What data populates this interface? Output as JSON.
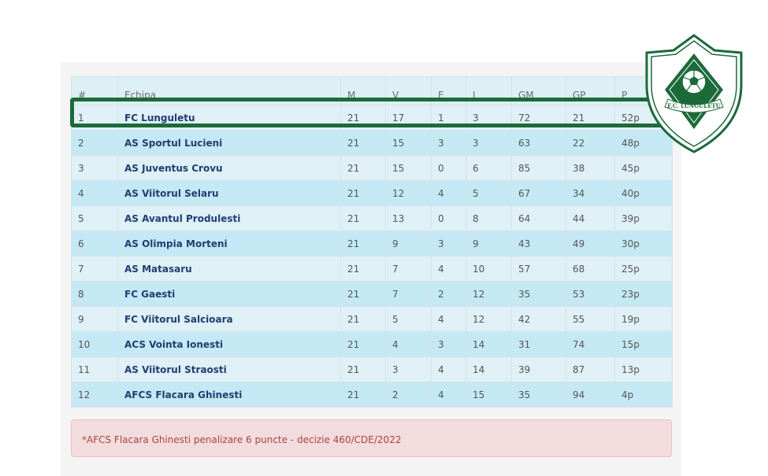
{
  "table": {
    "headers": {
      "rank": "#",
      "team": "Echipa",
      "played": "M",
      "won": "V",
      "drawn": "E",
      "lost": "I",
      "goals_for": "GM",
      "goals_against": "GP",
      "points": "P"
    },
    "rows": [
      {
        "rank": "1",
        "team": "FC Lunguletu",
        "played": "21",
        "won": "17",
        "drawn": "1",
        "lost": "3",
        "goals_for": "72",
        "goals_against": "21",
        "points": "52p"
      },
      {
        "rank": "2",
        "team": "AS Sportul Lucieni",
        "played": "21",
        "won": "15",
        "drawn": "3",
        "lost": "3",
        "goals_for": "63",
        "goals_against": "22",
        "points": "48p"
      },
      {
        "rank": "3",
        "team": "AS Juventus Crovu",
        "played": "21",
        "won": "15",
        "drawn": "0",
        "lost": "6",
        "goals_for": "85",
        "goals_against": "38",
        "points": "45p"
      },
      {
        "rank": "4",
        "team": "AS Viitorul Selaru",
        "played": "21",
        "won": "12",
        "drawn": "4",
        "lost": "5",
        "goals_for": "67",
        "goals_against": "34",
        "points": "40p"
      },
      {
        "rank": "5",
        "team": "AS Avantul Produlesti",
        "played": "21",
        "won": "13",
        "drawn": "0",
        "lost": "8",
        "goals_for": "64",
        "goals_against": "44",
        "points": "39p"
      },
      {
        "rank": "6",
        "team": "AS Olimpia Morteni",
        "played": "21",
        "won": "9",
        "drawn": "3",
        "lost": "9",
        "goals_for": "43",
        "goals_against": "49",
        "points": "30p"
      },
      {
        "rank": "7",
        "team": "AS Matasaru",
        "played": "21",
        "won": "7",
        "drawn": "4",
        "lost": "10",
        "goals_for": "57",
        "goals_against": "68",
        "points": "25p"
      },
      {
        "rank": "8",
        "team": "FC Gaesti",
        "played": "21",
        "won": "7",
        "drawn": "2",
        "lost": "12",
        "goals_for": "35",
        "goals_against": "53",
        "points": "23p"
      },
      {
        "rank": "9",
        "team": "FC Viitorul Salcioara",
        "played": "21",
        "won": "5",
        "drawn": "4",
        "lost": "12",
        "goals_for": "42",
        "goals_against": "55",
        "points": "19p"
      },
      {
        "rank": "10",
        "team": "ACS Vointa Ionesti",
        "played": "21",
        "won": "4",
        "drawn": "3",
        "lost": "14",
        "goals_for": "31",
        "goals_against": "74",
        "points": "15p"
      },
      {
        "rank": "11",
        "team": "AS Viitorul Straosti",
        "played": "21",
        "won": "3",
        "drawn": "4",
        "lost": "14",
        "goals_for": "39",
        "goals_against": "87",
        "points": "13p"
      },
      {
        "rank": "12",
        "team": "AFCS Flacara Ghinesti",
        "played": "21",
        "won": "2",
        "drawn": "4",
        "lost": "15",
        "goals_for": "35",
        "goals_against": "94",
        "points": "4p"
      }
    ]
  },
  "notice": {
    "text": "*AFCS Flacara Ghinesti penalizare 6 puncte - decizie 460/CDE/2022"
  },
  "logo": {
    "text": "F.C. LUNGULETU",
    "icon": "soccer-ball-icon"
  },
  "colors": {
    "highlight": "#1c6a3a",
    "team_text": "#1f3e72",
    "row_light": "#dff0f6",
    "row_dark": "#c5e9f4",
    "notice_text": "#a94442"
  }
}
